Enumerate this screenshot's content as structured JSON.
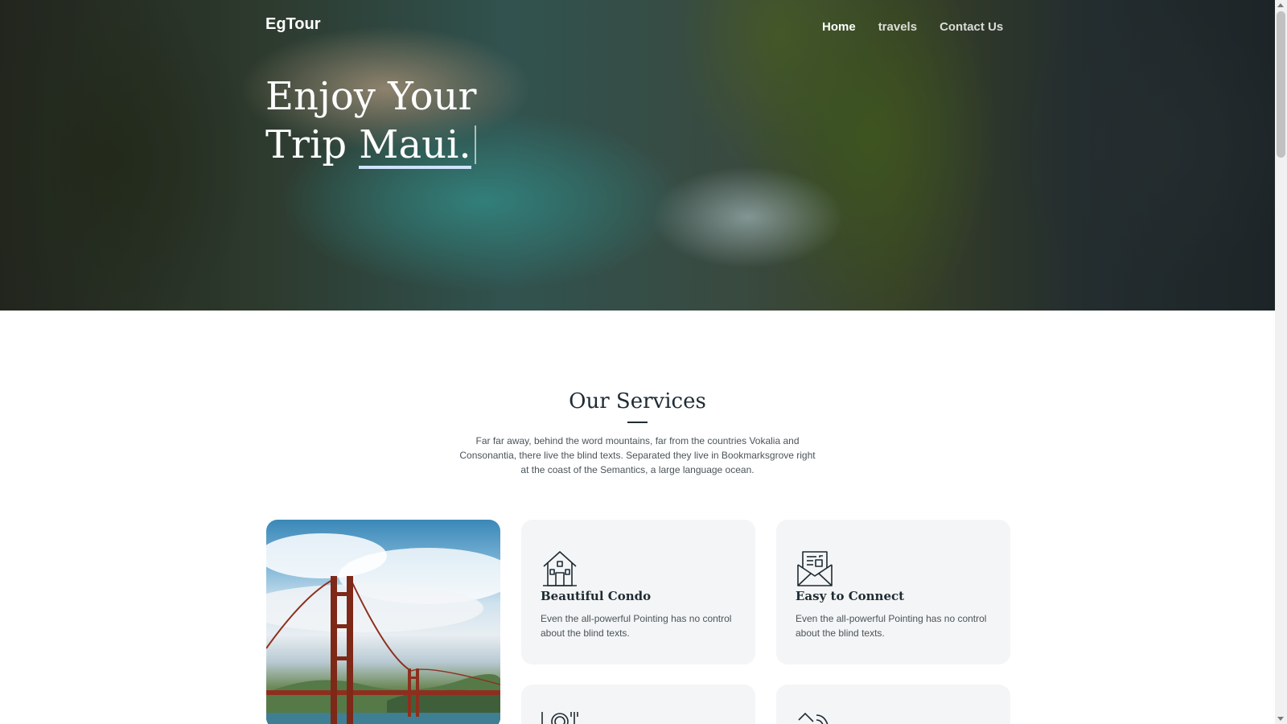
{
  "header": {
    "brand": "EgTour",
    "nav": [
      "Home",
      "travels",
      "Contact Us"
    ],
    "active_nav": "Home"
  },
  "hero": {
    "line1": "Enjoy Your",
    "line2_prefix": "Trip ",
    "typed_word": "Maui."
  },
  "services": {
    "title": "Our Services",
    "description": "Far far away, behind the word mountains, far from the countries Vokalia and Consonantia, there live the blind texts. Separated they live in Bookmarksgrove right at the coast of the Semantics, a large language ocean.",
    "cards": [
      {
        "icon": "house-icon",
        "title": "Beautiful Condo",
        "text": "Even the all-powerful Pointing has no control about the blind texts."
      },
      {
        "icon": "envelope-icon",
        "title": "Easy to Connect",
        "text": "Even the all-powerful Pointing has no control about the blind texts."
      }
    ],
    "photo": "golden-gate-bridge-photo",
    "partial_icons": [
      "dining-icon",
      "wifi-icon"
    ]
  },
  "colors": {
    "heading": "#1e2b33",
    "body_text": "#4a545a",
    "card_bg": "#f4f5f6",
    "hero_underline": "#cfe3ff"
  }
}
